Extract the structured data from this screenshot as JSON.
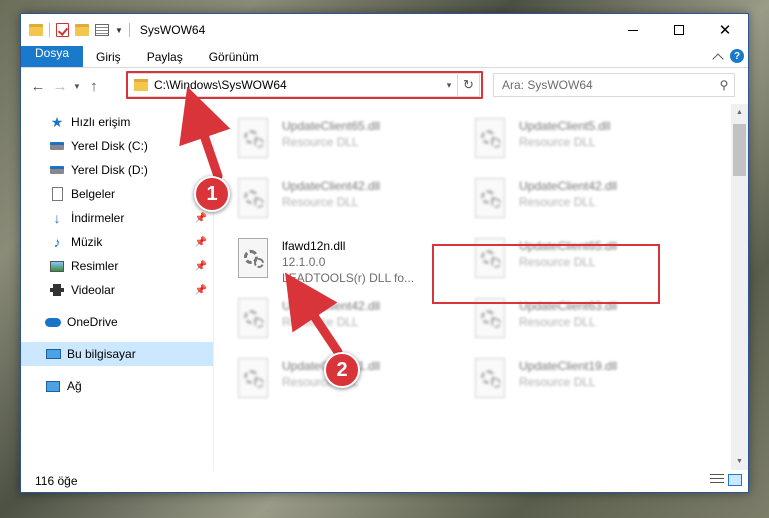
{
  "window": {
    "title": "SysWOW64",
    "controls": {
      "minimize": "minimize",
      "maximize": "maximize",
      "close": "✕"
    }
  },
  "ribbon": {
    "tabs": [
      {
        "label": "Dosya"
      },
      {
        "label": "Giriş"
      },
      {
        "label": "Paylaş"
      },
      {
        "label": "Görünüm"
      }
    ],
    "help": "?"
  },
  "nav": {
    "address": "C:\\Windows\\SysWOW64",
    "search_placeholder": "Ara: SysWOW64"
  },
  "sidebar": {
    "items": [
      {
        "label": "Hızlı erişim",
        "icon": "star-icon"
      },
      {
        "label": "Yerel Disk (C:)",
        "icon": "drive-icon"
      },
      {
        "label": "Yerel Disk (D:)",
        "icon": "drive-icon"
      },
      {
        "label": "Belgeler",
        "icon": "document-icon"
      },
      {
        "label": "İndirmeler",
        "icon": "download-icon"
      },
      {
        "label": "Müzik",
        "icon": "music-icon"
      },
      {
        "label": "Resimler",
        "icon": "pictures-icon"
      },
      {
        "label": "Videolar",
        "icon": "videos-icon"
      },
      {
        "label": "OneDrive",
        "icon": "onedrive-icon"
      },
      {
        "label": "Bu bilgisayar",
        "icon": "computer-icon"
      },
      {
        "label": "Ağ",
        "icon": "network-icon"
      }
    ]
  },
  "files": [
    {
      "name": "UpdateClient65.dll",
      "sub": "Resource DLL"
    },
    {
      "name": "UpdateClient5.dll",
      "sub": "Resource DLL"
    },
    {
      "name": "UpdateClient42.dll",
      "sub": "Resource DLL"
    },
    {
      "name": "UpdateClient42.dll",
      "sub": "Resource DLL"
    },
    {
      "name": "lfawd12n.dll",
      "version": "12.1.0.0",
      "sub": "LEADTOOLS(r) DLL fo..."
    },
    {
      "name": "UpdateClient65.dll",
      "sub": "Resource DLL"
    },
    {
      "name": "UpdateClient42.dll",
      "sub": "Resource DLL"
    },
    {
      "name": "UpdateClient63.dll",
      "sub": "Resource DLL"
    },
    {
      "name": "UpdateClient21.dll",
      "sub": "Resource DLL"
    },
    {
      "name": "UpdateClient19.dll",
      "sub": "Resource DLL"
    }
  ],
  "status": {
    "count": "116 öğe"
  },
  "callouts": {
    "one": "1",
    "two": "2"
  },
  "colors": {
    "accent": "#1979ca",
    "highlight": "#d9343a",
    "selected": "#cce8ff"
  }
}
